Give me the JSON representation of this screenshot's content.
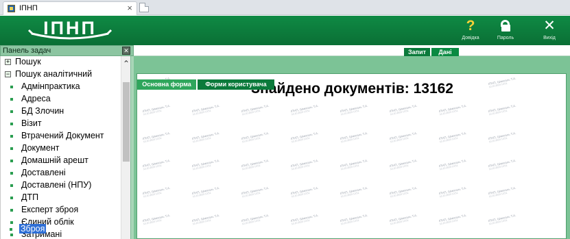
{
  "browser": {
    "tab_title": "ІПНП",
    "close_glyph": "×"
  },
  "app": {
    "logo_text": "ІПНП",
    "buttons": {
      "help": {
        "icon": "?",
        "label": "Довідка"
      },
      "password": {
        "label": "Пароль"
      },
      "exit": {
        "icon": "✕",
        "label": "Вихід"
      }
    }
  },
  "sidebar": {
    "title": "Панель задач",
    "collapse_glyph": "✕",
    "tree": [
      {
        "label": "Пошук",
        "expander": "+"
      },
      {
        "label": "Пошук аналітичний",
        "expander": "−"
      }
    ],
    "items": [
      "Адмінпрактика",
      "Адреса",
      "БД Злочин",
      "Візит",
      "Втрачений Документ",
      "Документ",
      "Домашній арешт",
      "Доставлені",
      "Доставлені (НПУ)",
      "ДТП",
      "Експерт зброя",
      "Єдиний облік",
      "Затримані",
      "Зброя"
    ],
    "selected_item": "Зброя",
    "scroll_up_glyph": "⌃"
  },
  "toolbar": {
    "query_label": "Запит",
    "data_label": "Дані"
  },
  "content": {
    "tabs": [
      "Основна форма",
      "Форми користувача"
    ],
    "active_tab": "Основна форма",
    "title": "Знайдено документів: 13162",
    "watermark_line1": "ІПНП, Шмигаль Т.А.",
    "watermark_line2": "10.10.2023 13:51"
  },
  "colors": {
    "header_green": "#0a6f35",
    "panel_green": "#7cc396",
    "selection_blue": "#2f6fd6",
    "help_yellow": "#f6d238"
  }
}
